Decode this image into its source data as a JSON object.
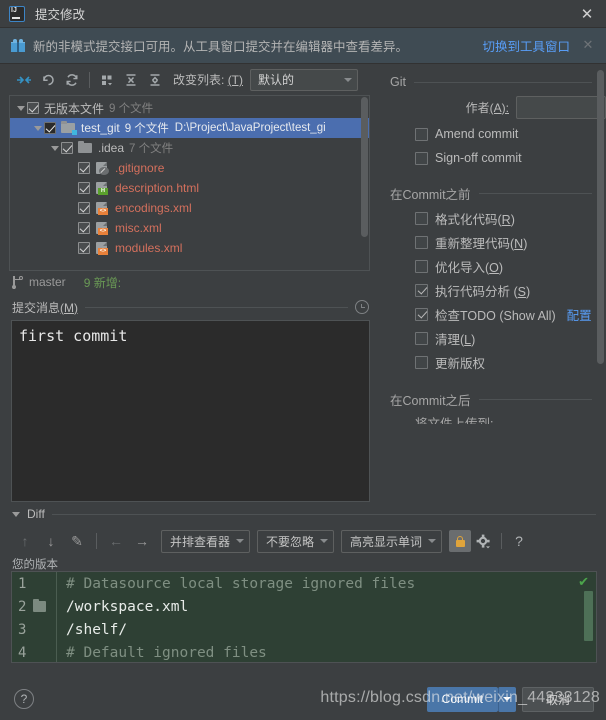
{
  "window": {
    "title": "提交修改",
    "close_label": "✕",
    "logo_text": "IJ"
  },
  "banner": {
    "icon": "gift-icon",
    "text": "新的非模式提交接口可用。从工具窗口提交并在编辑器中查看差异。",
    "link": "切换到工具窗口",
    "close_label": "✕"
  },
  "toolbar": {
    "buttons": [
      {
        "name": "collapse-to-selection-icon",
        "tip": "收起"
      },
      {
        "name": "revert-icon",
        "tip": "还原"
      },
      {
        "name": "refresh-icon",
        "tip": "刷新"
      },
      {
        "name": "group-by-icon",
        "tip": "分组依据"
      },
      {
        "name": "expand-all-icon",
        "tip": "全部展开"
      },
      {
        "name": "collapse-all-icon",
        "tip": "全部折叠"
      }
    ],
    "changelist_label": "改变列表:",
    "changelist_mnemonic": "(T)",
    "changelist_value": "默认的"
  },
  "tree": {
    "rows": [
      {
        "indent": 0,
        "arrow": true,
        "checked": true,
        "dark_cb": false,
        "icon": "none",
        "label": "无版本文件",
        "label_kind": "group",
        "count": "9 个文件",
        "path": ""
      },
      {
        "indent": 1,
        "arrow": true,
        "checked": true,
        "dark_cb": true,
        "icon": "folder-vcs",
        "label": "test_git",
        "label_kind": "folder",
        "count": "9 个文件",
        "path": "D:\\Project\\JavaProject\\test_gi",
        "selected": true
      },
      {
        "indent": 2,
        "arrow": true,
        "checked": true,
        "dark_cb": false,
        "icon": "folder",
        "label": ".idea",
        "label_kind": "folder",
        "count": "7 个文件",
        "path": ""
      },
      {
        "indent": 3,
        "arrow": false,
        "checked": true,
        "dark_cb": false,
        "icon": "file-ignore",
        "label": ".gitignore",
        "label_kind": "file",
        "count": "",
        "path": ""
      },
      {
        "indent": 3,
        "arrow": false,
        "checked": true,
        "dark_cb": false,
        "icon": "file-html",
        "label": "description.html",
        "label_kind": "file",
        "count": "",
        "path": ""
      },
      {
        "indent": 3,
        "arrow": false,
        "checked": true,
        "dark_cb": false,
        "icon": "file-xml",
        "label": "encodings.xml",
        "label_kind": "file",
        "count": "",
        "path": ""
      },
      {
        "indent": 3,
        "arrow": false,
        "checked": true,
        "dark_cb": false,
        "icon": "file-xml",
        "label": "misc.xml",
        "label_kind": "file",
        "count": "",
        "path": ""
      },
      {
        "indent": 3,
        "arrow": false,
        "checked": true,
        "dark_cb": false,
        "icon": "file-xml",
        "label": "modules.xml",
        "label_kind": "file",
        "count": "",
        "path": ""
      }
    ]
  },
  "branch": {
    "icon": "branch-icon",
    "name": "master",
    "stat": "9 新增:"
  },
  "commit_message": {
    "label": "提交消息",
    "mnemonic": "(M)",
    "history_icon": "clock-icon",
    "value": "first commit",
    "placeholder": ""
  },
  "git_panel": {
    "section_title": "Git",
    "author_label": "作者",
    "author_mnemonic": "(A):",
    "author_value": "",
    "checkboxes": [
      {
        "label": "Amend commit",
        "checked": false,
        "name": "amend-commit-checkbox"
      },
      {
        "label": "Sign-off commit",
        "checked": false,
        "name": "sign-off-commit-checkbox"
      }
    ]
  },
  "before_commit": {
    "section_title": "在Commit之前",
    "items": [
      {
        "label": "格式化代码(R)",
        "checked": false,
        "name": "reformat-code-checkbox",
        "link": ""
      },
      {
        "label": "重新整理代码(N)",
        "checked": false,
        "name": "rearrange-code-checkbox",
        "link": ""
      },
      {
        "label": "优化导入(O)",
        "checked": false,
        "name": "optimize-imports-checkbox",
        "link": ""
      },
      {
        "label": "执行代码分析 (S)",
        "checked": true,
        "name": "analyze-code-checkbox",
        "link": ""
      },
      {
        "label": "检查TODO (Show All)",
        "checked": true,
        "name": "check-todo-checkbox",
        "link": "配置"
      },
      {
        "label": "清理(L)",
        "checked": false,
        "name": "cleanup-checkbox",
        "link": ""
      },
      {
        "label": "更新版权",
        "checked": false,
        "name": "update-copyright-checkbox",
        "link": ""
      }
    ]
  },
  "after_commit": {
    "section_title": "在Commit之后",
    "note": "将文件上传到:"
  },
  "diff": {
    "section_title": "Diff",
    "buttons": [
      {
        "name": "previous-difference-icon",
        "glyph": "↑",
        "dim": true
      },
      {
        "name": "next-difference-icon",
        "glyph": "↓",
        "dim": false
      },
      {
        "name": "edit-source-icon",
        "glyph": "✎",
        "dim": false
      },
      {
        "name": "accept-left-icon",
        "glyph": "←",
        "dim": true
      },
      {
        "name": "accept-right-icon",
        "glyph": "→",
        "dim": false
      }
    ],
    "dropdowns": [
      {
        "name": "viewer-mode-dropdown",
        "value": "并排查看器"
      },
      {
        "name": "ignore-policy-dropdown",
        "value": "不要忽略"
      },
      {
        "name": "highlight-mode-dropdown",
        "value": "高亮显示单词"
      }
    ],
    "lock_icon": "lock-icon",
    "settings_icon": "gear-icon",
    "help_icon": "question-mark-icon",
    "pane_label": "您的版本",
    "status_check": "✔",
    "lines": [
      {
        "num": "1",
        "text": "# Default ignored files",
        "kind": "comment",
        "fold": false
      },
      {
        "num": "2",
        "text": "/shelf/",
        "kind": "code",
        "fold": true
      },
      {
        "num": "3",
        "text": "/workspace.xml",
        "kind": "code",
        "fold": false
      },
      {
        "num": "4",
        "text": "# Datasource local storage ignored files",
        "kind": "comment",
        "fold": false
      }
    ]
  },
  "footer": {
    "help_label": "?",
    "commit_label": "Commit",
    "cancel_label": "取消"
  },
  "watermark": {
    "text": "https://blog.csdn.net/weixin_44333128"
  }
}
